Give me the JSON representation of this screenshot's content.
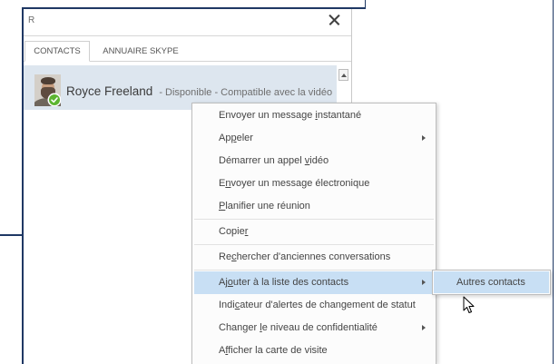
{
  "search": {
    "value": "R"
  },
  "tabs": [
    {
      "label": "CONTACTS",
      "selected": true
    },
    {
      "label": "ANNUAIRE SKYPE",
      "selected": false
    }
  ],
  "contact": {
    "name": "Royce Freeland",
    "status": "- Disponible - Compatible avec la vidéo",
    "selected": true
  },
  "context_menu": {
    "items": [
      {
        "label": "Envoyer un message instantané",
        "access_key_index": 19,
        "has_submenu": false,
        "highlighted": false
      },
      {
        "label": "Appeler",
        "access_key_index": 2,
        "has_submenu": true,
        "highlighted": false
      },
      {
        "label": "Démarrer un appel vidéo",
        "access_key_index": 18,
        "has_submenu": false,
        "highlighted": false
      },
      {
        "label": "Envoyer un message électronique",
        "access_key_index": 1,
        "has_submenu": false,
        "highlighted": false
      },
      {
        "label": "Planifier une réunion",
        "access_key_index": 0,
        "has_submenu": false,
        "highlighted": false
      },
      {
        "label": "Copier",
        "access_key_index": 5,
        "has_submenu": false,
        "highlighted": false
      },
      {
        "label": "Rechercher d'anciennes conversations",
        "access_key_index": 2,
        "has_submenu": false,
        "highlighted": false
      },
      {
        "label": "Ajouter à la liste des contacts",
        "access_key_index": 2,
        "has_submenu": true,
        "highlighted": true
      },
      {
        "label": "Indicateur d'alertes de changement de statut",
        "access_key_index": 4,
        "has_submenu": false,
        "highlighted": false
      },
      {
        "label": "Changer le niveau de confidentialité",
        "access_key_index": 8,
        "has_submenu": true,
        "highlighted": false
      },
      {
        "label": "Afficher la carte de visite",
        "access_key_index": 1,
        "has_submenu": false,
        "highlighted": false
      }
    ]
  },
  "submenu": {
    "items": [
      {
        "label": "Autres contacts",
        "highlighted": true
      }
    ]
  },
  "icons": {
    "close": "close-icon",
    "presence": "presence-available-icon",
    "scroll_up": "chevron-up-icon",
    "submenu_arrow": "submenu-arrow-icon",
    "cursor": "mouse-cursor-icon"
  },
  "colors": {
    "highlight": "#c8dff4",
    "contact_row": "#dde6ef",
    "presence_available": "#5cb531",
    "frame": "#1f3864",
    "menu_text": "#444444"
  }
}
